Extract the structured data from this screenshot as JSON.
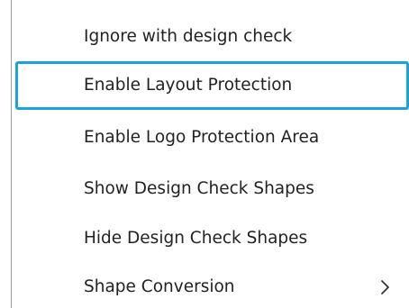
{
  "menu": {
    "items": [
      {
        "label": "Ignore with design check",
        "highlighted": false,
        "has_submenu": false
      },
      {
        "label": "Enable Layout Protection",
        "highlighted": true,
        "has_submenu": false
      },
      {
        "label": "Enable Logo Protection Area",
        "highlighted": false,
        "has_submenu": false
      },
      {
        "label": "Show Design Check Shapes",
        "highlighted": false,
        "has_submenu": false
      },
      {
        "label": "Hide Design Check Shapes",
        "highlighted": false,
        "has_submenu": false
      },
      {
        "label": "Shape Conversion",
        "highlighted": false,
        "has_submenu": true,
        "submenu_icon": "chevron-right-icon"
      }
    ],
    "highlight_color": "#1aa3dc",
    "text_color": "#222222"
  }
}
